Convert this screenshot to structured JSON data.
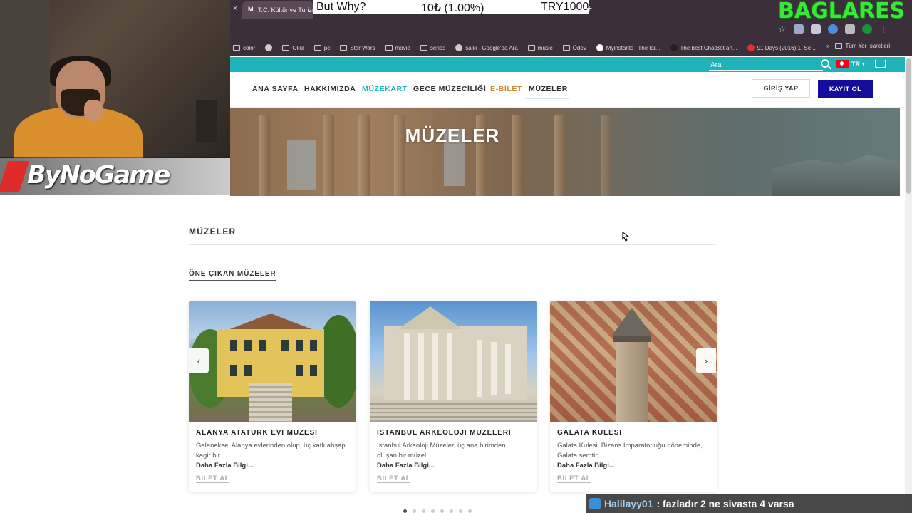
{
  "overlay": {
    "logo_text": "ByNoGame",
    "brand_text": "BAGLARES",
    "ticker": {
      "text": "But Why?",
      "price": "10₺ (1.00%)",
      "goal": "TRY1000"
    },
    "chat": {
      "user": "Halilayy01",
      "message": ": fazladır 2 ne sivasta 4 varsa"
    }
  },
  "browser": {
    "tab_title": "T.C. Kültür ve Turizm Bakanlığı",
    "tab_close": "×",
    "new_tab": "+",
    "bookmarks": [
      {
        "label": "color",
        "icon": "folder-icon"
      },
      {
        "label": "",
        "icon": "globe-icon"
      },
      {
        "label": "Okul",
        "icon": "folder-icon"
      },
      {
        "label": "pc",
        "icon": "folder-icon"
      },
      {
        "label": "Star Wars",
        "icon": "folder-icon"
      },
      {
        "label": "movie",
        "icon": "folder-icon"
      },
      {
        "label": "series",
        "icon": "folder-icon"
      },
      {
        "label": "saiki - Google'da Ara",
        "icon": "google-icon"
      },
      {
        "label": "music",
        "icon": "folder-icon"
      },
      {
        "label": "Ödev",
        "icon": "folder-icon"
      },
      {
        "label": "Myinstants | The lar...",
        "icon": "site-icon"
      },
      {
        "label": "The best ChatBot an...",
        "icon": "site-icon"
      },
      {
        "label": "91 Days (2016) 1. Se...",
        "icon": "site-icon"
      }
    ],
    "bookmarks_more": "»",
    "all_bookmarks": "Tüm Yer İşaretleri"
  },
  "site": {
    "search_placeholder": "Ara",
    "lang": "TR",
    "nav": [
      {
        "label": "ANA SAYFA",
        "color": "#2d2d2d"
      },
      {
        "label": "HAKKIMIZDA",
        "color": "#2d2d2d"
      },
      {
        "label": "MÜZEKART",
        "color": "#1fb2b9"
      },
      {
        "label": "GECE MÜZECİLİĞİ",
        "color": "#2d2d2d"
      },
      {
        "label": "E-BİLET",
        "color": "#d08a3c"
      },
      {
        "label": "MÜZELER",
        "color": "#2d2d2d"
      }
    ],
    "login": "GİRİŞ YAP",
    "register": "KAYIT OL",
    "hero_title": "MÜZELER",
    "section_heading": "MÜZELER",
    "featured_heading": "ÖNE ÇIKAN MÜZELER",
    "cards": [
      {
        "title": "ALANYA ATATURK EVI MUZESI",
        "desc": "Geleneksel Alanya evlerinden olup, üç katlı ahşap kagir bir ...",
        "more": "Daha Fazla Bilgi...",
        "ticket": "BİLET AL"
      },
      {
        "title": "ISTANBUL ARKEOLOJI MUZELERI",
        "desc": "İstanbul Arkeoloji Müzeleri üç ana birimden oluşan bir müzel...",
        "more": "Daha Fazla Bilgi...",
        "ticket": "BİLET AL"
      },
      {
        "title": "GALATA KULESI",
        "desc": "Galata Kulesi, Bizans İmparatorluğu döneminde, Galata semtin...",
        "more": "Daha Fazla Bilgi...",
        "ticket": "BİLET AL"
      }
    ],
    "carousel_prev": "‹",
    "carousel_next": "›",
    "colors": {
      "topbar": "#1fb2b9",
      "register_button": "#150b9c"
    }
  }
}
